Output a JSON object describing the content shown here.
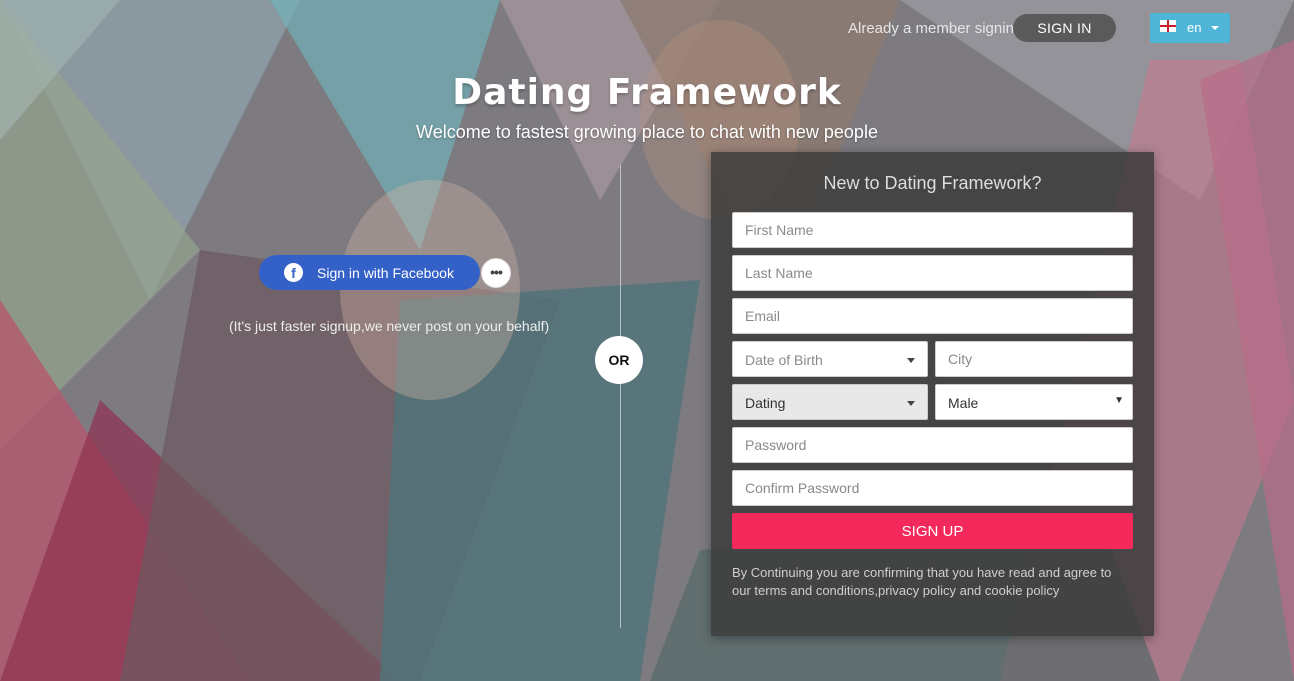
{
  "topbar": {
    "member_text": "Already a member signin",
    "signin_label": "SIGN IN",
    "language": "en"
  },
  "hero": {
    "brand": "Dating Framework",
    "tagline": "Welcome to fastest growing place to chat with new people"
  },
  "social": {
    "facebook_label": "Sign in with Facebook",
    "more_label": "•••",
    "note": "(It's just faster signup,we never post on your behalf)",
    "or_label": "OR"
  },
  "signup": {
    "title": "New to Dating Framework?",
    "first_name_placeholder": "First Name",
    "last_name_placeholder": "Last Name",
    "email_placeholder": "Email",
    "dob_placeholder": "Date of Birth",
    "city_placeholder": "City",
    "looking_for_value": "Dating",
    "gender_value": "Male",
    "password_placeholder": "Password",
    "confirm_password_placeholder": "Confirm Password",
    "submit_label": "SIGN UP",
    "terms": "By Continuing you are confirming that you have read and agree to our terms and conditions,privacy policy and cookie policy"
  },
  "colors": {
    "accent": "#f2295a",
    "facebook": "#3461c7",
    "language_button": "#4fb5d6",
    "card_background": "#3e3e3e"
  },
  "icons": {
    "facebook": "facebook-icon",
    "more": "more-dots-icon",
    "flag": "england-flag-icon",
    "dropdown": "caret-down-icon"
  }
}
